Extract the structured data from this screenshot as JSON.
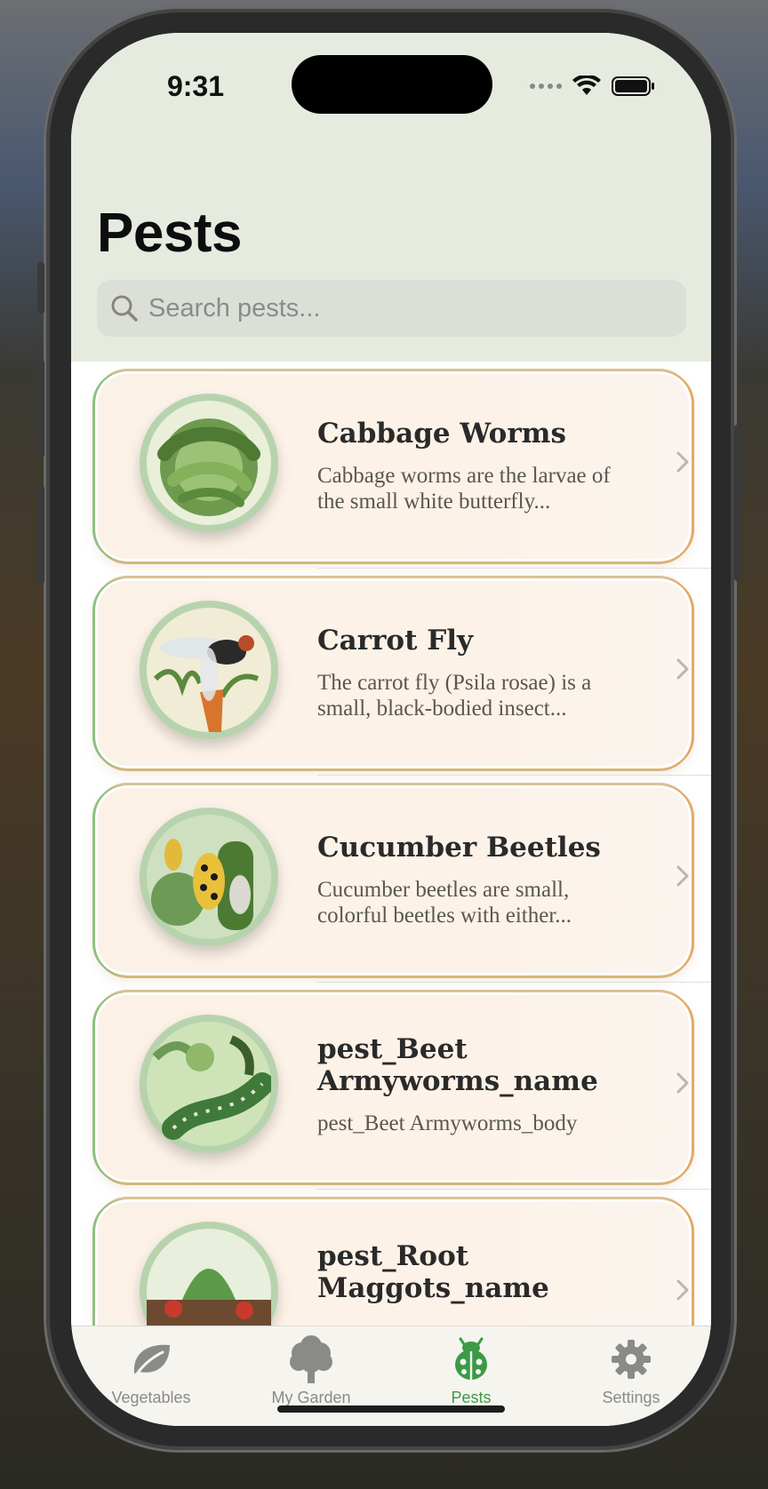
{
  "status_bar": {
    "time": "9:31"
  },
  "header": {
    "title": "Pests"
  },
  "search": {
    "placeholder": "Search pests..."
  },
  "pests": [
    {
      "name": "Cabbage Worms",
      "description": "Cabbage worms are the larvae of the small white butterfly..."
    },
    {
      "name": "Carrot Fly",
      "description": "The carrot fly (Psila rosae) is a small, black-bodied insect..."
    },
    {
      "name": "Cucumber Beetles",
      "description": "Cucumber beetles are small, colorful beetles with either..."
    },
    {
      "name": "pest_Beet Armyworms_name",
      "description": "pest_Beet Armyworms_body"
    },
    {
      "name": "pest_Root Maggots_name",
      "description": ""
    }
  ],
  "tabbar": {
    "items": [
      {
        "label": "Vegetables",
        "icon": "leaf-icon"
      },
      {
        "label": "My Garden",
        "icon": "tree-icon"
      },
      {
        "label": "Pests",
        "icon": "ladybug-icon",
        "active": true
      },
      {
        "label": "Settings",
        "icon": "gear-icon"
      }
    ]
  },
  "colors": {
    "accent_green": "#3a9a47",
    "header_bg": "#e6ebe0",
    "card_bg": "#fcf2e8",
    "border_green": "#8fbf82",
    "border_orange": "#e7a862"
  }
}
